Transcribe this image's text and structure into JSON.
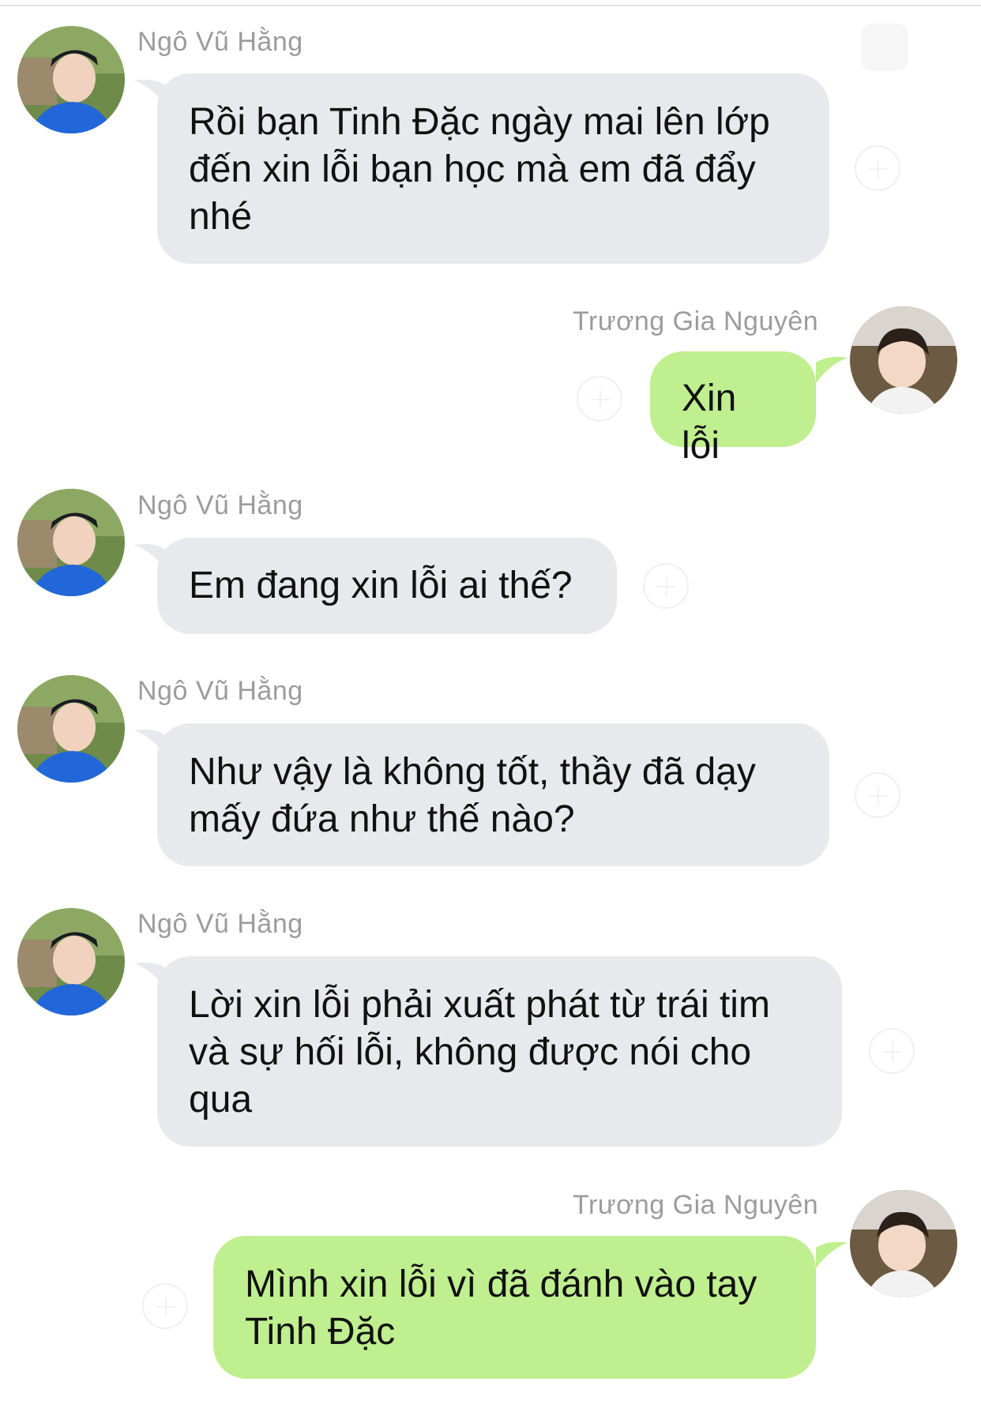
{
  "chat": {
    "messages": [
      {
        "sender": "Ngô Vũ Hằng",
        "direction": "incoming",
        "text": "Rồi bạn Tinh Đặc ngày mai lên lớp đến xin lỗi bạn học mà em đã đẩy nhé"
      },
      {
        "sender": "Trương Gia Nguyên",
        "direction": "outgoing",
        "text": "Xin lỗi"
      },
      {
        "sender": "Ngô Vũ Hằng",
        "direction": "incoming",
        "text": "Em đang xin lỗi ai thế?"
      },
      {
        "sender": "Ngô Vũ Hằng",
        "direction": "incoming",
        "text": "Như vậy là không tốt, thầy đã dạy mấy đứa như thế nào?"
      },
      {
        "sender": "Ngô Vũ Hằng",
        "direction": "incoming",
        "text": "Lời xin lỗi phải xuất phát từ trái tim và sự hối lỗi, không được nói cho qua"
      },
      {
        "sender": "Trương Gia Nguyên",
        "direction": "outgoing",
        "text": "Mình xin lỗi vì đã đánh vào tay Tinh Đặc"
      }
    ]
  },
  "colors": {
    "incoming_bubble": "#e8e9ec",
    "outgoing_bubble": "#c0ef8f",
    "sender_name": "#9b9ba0",
    "text": "#111111"
  },
  "icons": {
    "incoming_avatar": "avatar-photo-icon",
    "outgoing_avatar": "avatar-photo-icon",
    "reaction": "add-reaction-icon"
  }
}
